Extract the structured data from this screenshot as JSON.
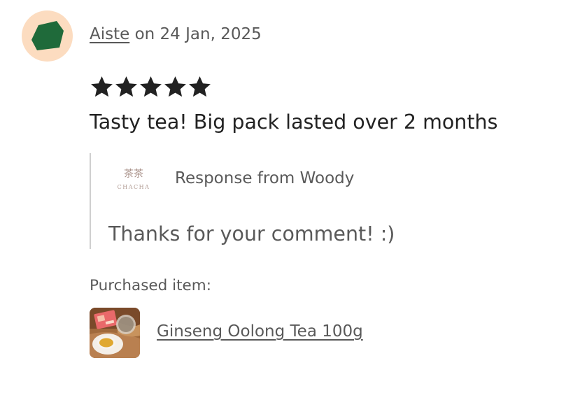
{
  "review": {
    "reviewer_name": "Aiste",
    "date_text": " on 24 Jan, 2025",
    "rating": 5,
    "rating_max": 5,
    "text": "Tasty tea! Big pack lasted over 2 months"
  },
  "response": {
    "shop_logo_text": "茶茶",
    "shop_logo_subtext": "CHACHA",
    "header": "Response from Woody",
    "text": "Thanks for your comment! :)"
  },
  "purchase": {
    "label": "Purchased item:",
    "item_name": "Ginseng Oolong Tea 100g",
    "thumbnail_icon": "product-photo"
  },
  "colors": {
    "avatar_bg": "#fcdcc0",
    "avatar_shape": "#1f6a3a",
    "text_primary": "#222222",
    "text_secondary": "#595959",
    "divider": "#cfcfcf"
  }
}
